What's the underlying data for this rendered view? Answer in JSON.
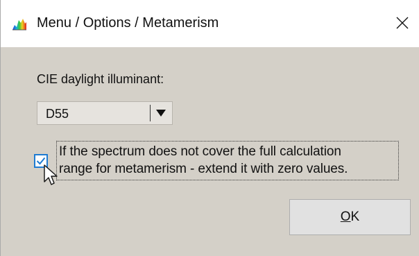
{
  "window": {
    "title": "Menu / Options / Metamerism",
    "app_icon": "spectrum-icon",
    "close_icon": "close-icon"
  },
  "illuminant": {
    "label": "CIE daylight illuminant:",
    "selected": "D55",
    "dropdown_icon": "triangle-down-icon"
  },
  "extend_option": {
    "checked": true,
    "line1": "If the spectrum does not cover the full calculation",
    "line2": "range for metamerism - extend it with zero values."
  },
  "ok_button": {
    "mnemonic": "O",
    "rest": "K"
  },
  "colors": {
    "dialog_bg": "#d4d0c8",
    "titlebar_bg": "#ffffff",
    "checkbox_accent": "#1e7bd2",
    "button_bg": "#e1e1e1"
  }
}
